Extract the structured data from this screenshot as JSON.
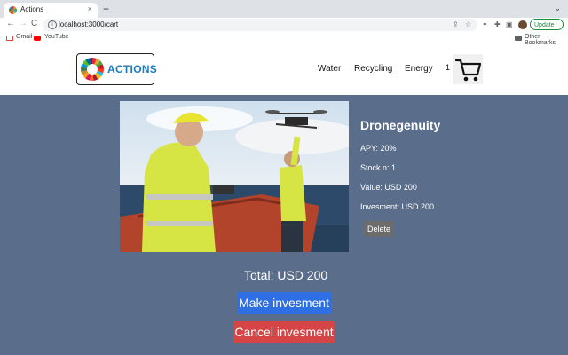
{
  "browser": {
    "tab_title": "Actions",
    "tab_close": "×",
    "new_tab": "+",
    "tab_menu": "⌄",
    "url": "localhost:3000/cart",
    "update_label": "Update",
    "update_more": "⋮",
    "bookmarks": [
      "Gmail",
      "YouTube"
    ],
    "other_bookmarks": "Other Bookmarks",
    "nav": {
      "back": "←",
      "forward": "→",
      "reload": "C"
    },
    "info_glyph": "i",
    "share_glyph": "⇪",
    "star_glyph": "☆",
    "ext_glyph": "✦",
    "puzzle_glyph": "✚",
    "sidebar_glyph": "▣"
  },
  "site": {
    "logo_text": "ACTIONS",
    "nav": [
      "Water",
      "Recycling",
      "Energy"
    ],
    "cart_count": "1"
  },
  "product": {
    "name": "Dronegenuity",
    "apy": "APY: 20%",
    "stock": "Stock n: 1",
    "value": "Value: USD 200",
    "investment": "Invesment: USD 200",
    "delete_label": "Delete"
  },
  "cart": {
    "total": "Total: USD 200",
    "make_label": "Make invesment",
    "cancel_label": "Cancel invesment"
  },
  "colors": {
    "page_bg": "#5a6e8c",
    "make_button": "#2f6fe4",
    "cancel_button": "#d64545",
    "delete_button": "#6c6c6c",
    "logo_text": "#1a7bbf"
  }
}
